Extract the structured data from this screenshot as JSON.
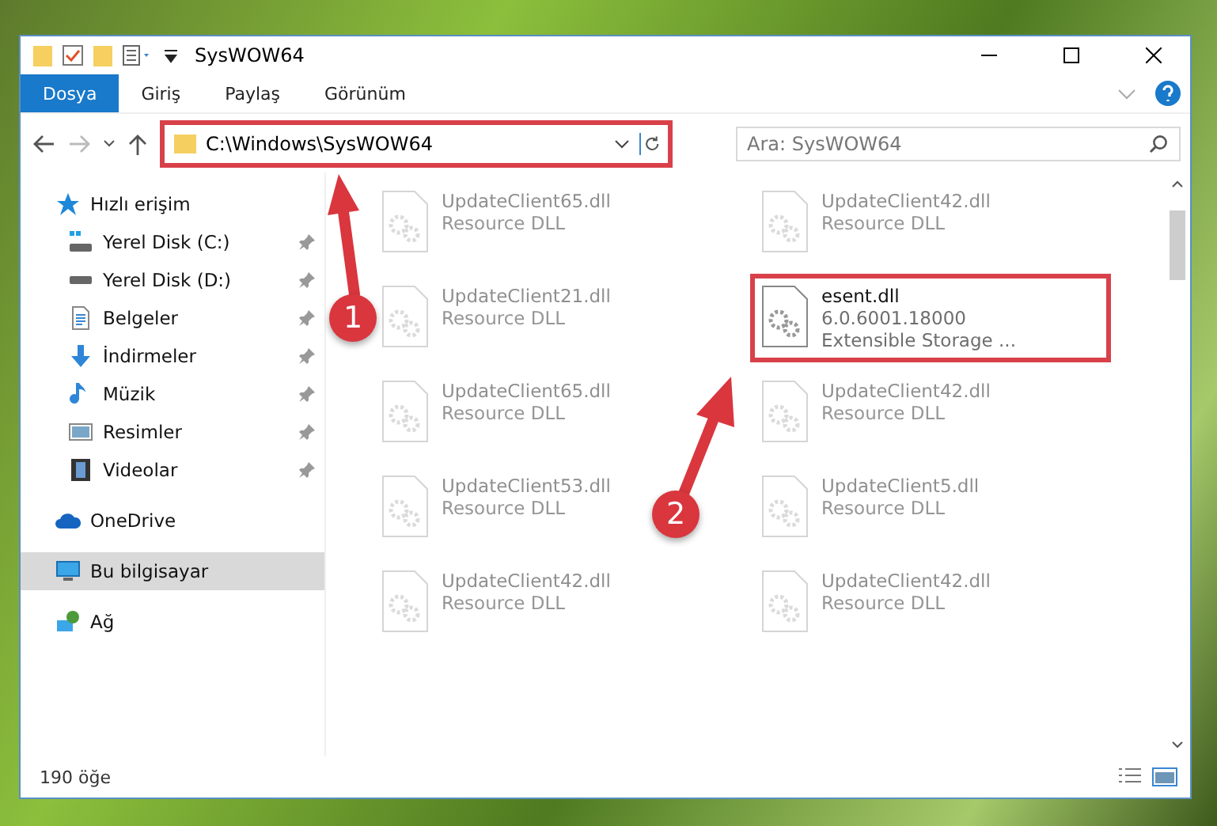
{
  "window": {
    "title": "SysWOW64"
  },
  "ribbon": {
    "tabs": [
      {
        "label": "Dosya",
        "selected": true
      },
      {
        "label": "Giriş",
        "selected": false
      },
      {
        "label": "Paylaş",
        "selected": false
      },
      {
        "label": "Görünüm",
        "selected": false
      }
    ]
  },
  "address_bar": {
    "path": "C:\\Windows\\SysWOW64",
    "highlighted": true
  },
  "search": {
    "placeholder": "Ara: SysWOW64"
  },
  "sidebar": {
    "items": [
      {
        "label": "Hızlı erişim",
        "kind": "star",
        "selected": false,
        "children": [
          {
            "label": "Yerel Disk (C:)",
            "kind": "drive-win",
            "pinned": true,
            "selected": false
          },
          {
            "label": "Yerel Disk (D:)",
            "kind": "drive",
            "pinned": true,
            "selected": false
          },
          {
            "label": "Belgeler",
            "kind": "document",
            "pinned": true,
            "selected": false
          },
          {
            "label": "İndirmeler",
            "kind": "download",
            "pinned": true,
            "selected": false
          },
          {
            "label": "Müzik",
            "kind": "music",
            "pinned": true,
            "selected": false
          },
          {
            "label": "Resimler",
            "kind": "picture",
            "pinned": true,
            "selected": false
          },
          {
            "label": "Videolar",
            "kind": "video",
            "pinned": true,
            "selected": false
          }
        ]
      },
      {
        "label": "OneDrive",
        "kind": "cloud",
        "selected": false
      },
      {
        "label": "Bu bilgisayar",
        "kind": "computer",
        "selected": true
      },
      {
        "label": "Ağ",
        "kind": "network",
        "selected": false
      }
    ]
  },
  "files": [
    {
      "name": "UpdateClient65.dll",
      "lines": [
        "Resource DLL"
      ],
      "faded": true,
      "highlighted": false
    },
    {
      "name": "UpdateClient42.dll",
      "lines": [
        "Resource DLL"
      ],
      "faded": true,
      "highlighted": false
    },
    {
      "name": "UpdateClient21.dll",
      "lines": [
        "Resource DLL"
      ],
      "faded": true,
      "highlighted": false
    },
    {
      "name": "esent.dll",
      "lines": [
        "6.0.6001.18000",
        "Extensible Storage ..."
      ],
      "faded": false,
      "highlighted": true
    },
    {
      "name": "UpdateClient65.dll",
      "lines": [
        "Resource DLL"
      ],
      "faded": true,
      "highlighted": false
    },
    {
      "name": "UpdateClient42.dll",
      "lines": [
        "Resource DLL"
      ],
      "faded": true,
      "highlighted": false
    },
    {
      "name": "UpdateClient53.dll",
      "lines": [
        "Resource DLL"
      ],
      "faded": true,
      "highlighted": false
    },
    {
      "name": "UpdateClient5.dll",
      "lines": [
        "Resource DLL"
      ],
      "faded": true,
      "highlighted": false
    },
    {
      "name": "UpdateClient42.dll",
      "lines": [
        "Resource DLL"
      ],
      "faded": true,
      "highlighted": false
    },
    {
      "name": "UpdateClient42.dll",
      "lines": [
        "Resource DLL"
      ],
      "faded": true,
      "highlighted": false
    }
  ],
  "status_bar": {
    "count": "190 öğe"
  },
  "annotations": [
    {
      "label": "1"
    },
    {
      "label": "2"
    }
  ]
}
